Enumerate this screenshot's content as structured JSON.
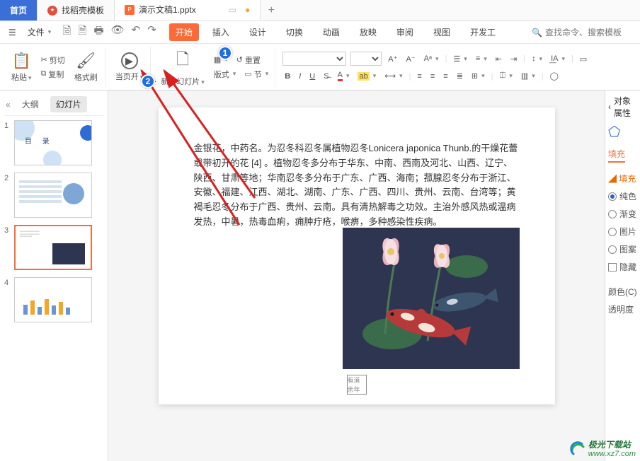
{
  "tabs": {
    "home": "首页",
    "template_tab": "找稻壳模板",
    "doc_tab": "演示文稿1.pptx",
    "plus": "+"
  },
  "menu": {
    "file": "文件",
    "ribbon_tabs": [
      "开始",
      "插入",
      "设计",
      "切换",
      "动画",
      "放映",
      "审阅",
      "视图",
      "开发工"
    ],
    "active_index": 0,
    "search_placeholder": "查找命令、搜索模板"
  },
  "ribbon": {
    "paste": "粘贴",
    "cut": "剪切",
    "copy": "复制",
    "format_painter": "格式刷",
    "from_current": "当页开",
    "new_slide": "新建幻灯片",
    "layout": "版式",
    "section": "节",
    "reset": "重置",
    "font_label": "",
    "text_box": "文本框"
  },
  "side": {
    "outline": "大纲",
    "slides": "幻灯片",
    "thumb1_title": "目    录",
    "numbers": [
      "1",
      "2",
      "3",
      "4"
    ]
  },
  "slide": {
    "paragraph": "金银花，中药名。为忍冬科忍冬属植物忍冬Lonicera japonica Thunb.的干燥花蕾或带初开的花 [4] 。植物忍冬多分布于华东、中南、西南及河北、山西、辽宁、陕西、甘肃等地；华南忍冬多分布于广东、广西、海南；菰腺忍冬分布于浙江、安徽、福建、江西、湖北、湖南、广东、广西、四川、贵州、云南、台湾等；黄褐毛忍冬分布于广西、贵州、云南。具有清热解毒之功效。主治外感风热或温病发热，中暑，热毒血痢，痈肿疔疮，喉痹，多种感染性疾病。",
    "stamp": "有道余年"
  },
  "prop": {
    "header": "对象属性",
    "fill": "填充",
    "fill_section": "填充",
    "solid": "纯色",
    "gradient": "渐变",
    "pic": "图片",
    "pattern": "图案",
    "hide": "隐藏",
    "color": "颜色(C)",
    "transparency": "透明度"
  },
  "watermark": {
    "name": "极光下载站",
    "url": "www.xz7.com"
  },
  "annotations": {
    "n1": "1",
    "n2": "2"
  },
  "chart_data": {
    "type": "bar",
    "note": "thumbnail #4 depicts a small bar chart preview; exact values are not readable in the screenshot",
    "categories": [
      "",
      "",
      "",
      "",
      "",
      "",
      ""
    ],
    "values": [
      40,
      55,
      30,
      60,
      35,
      50,
      28
    ],
    "ylim": [
      0,
      70
    ]
  }
}
